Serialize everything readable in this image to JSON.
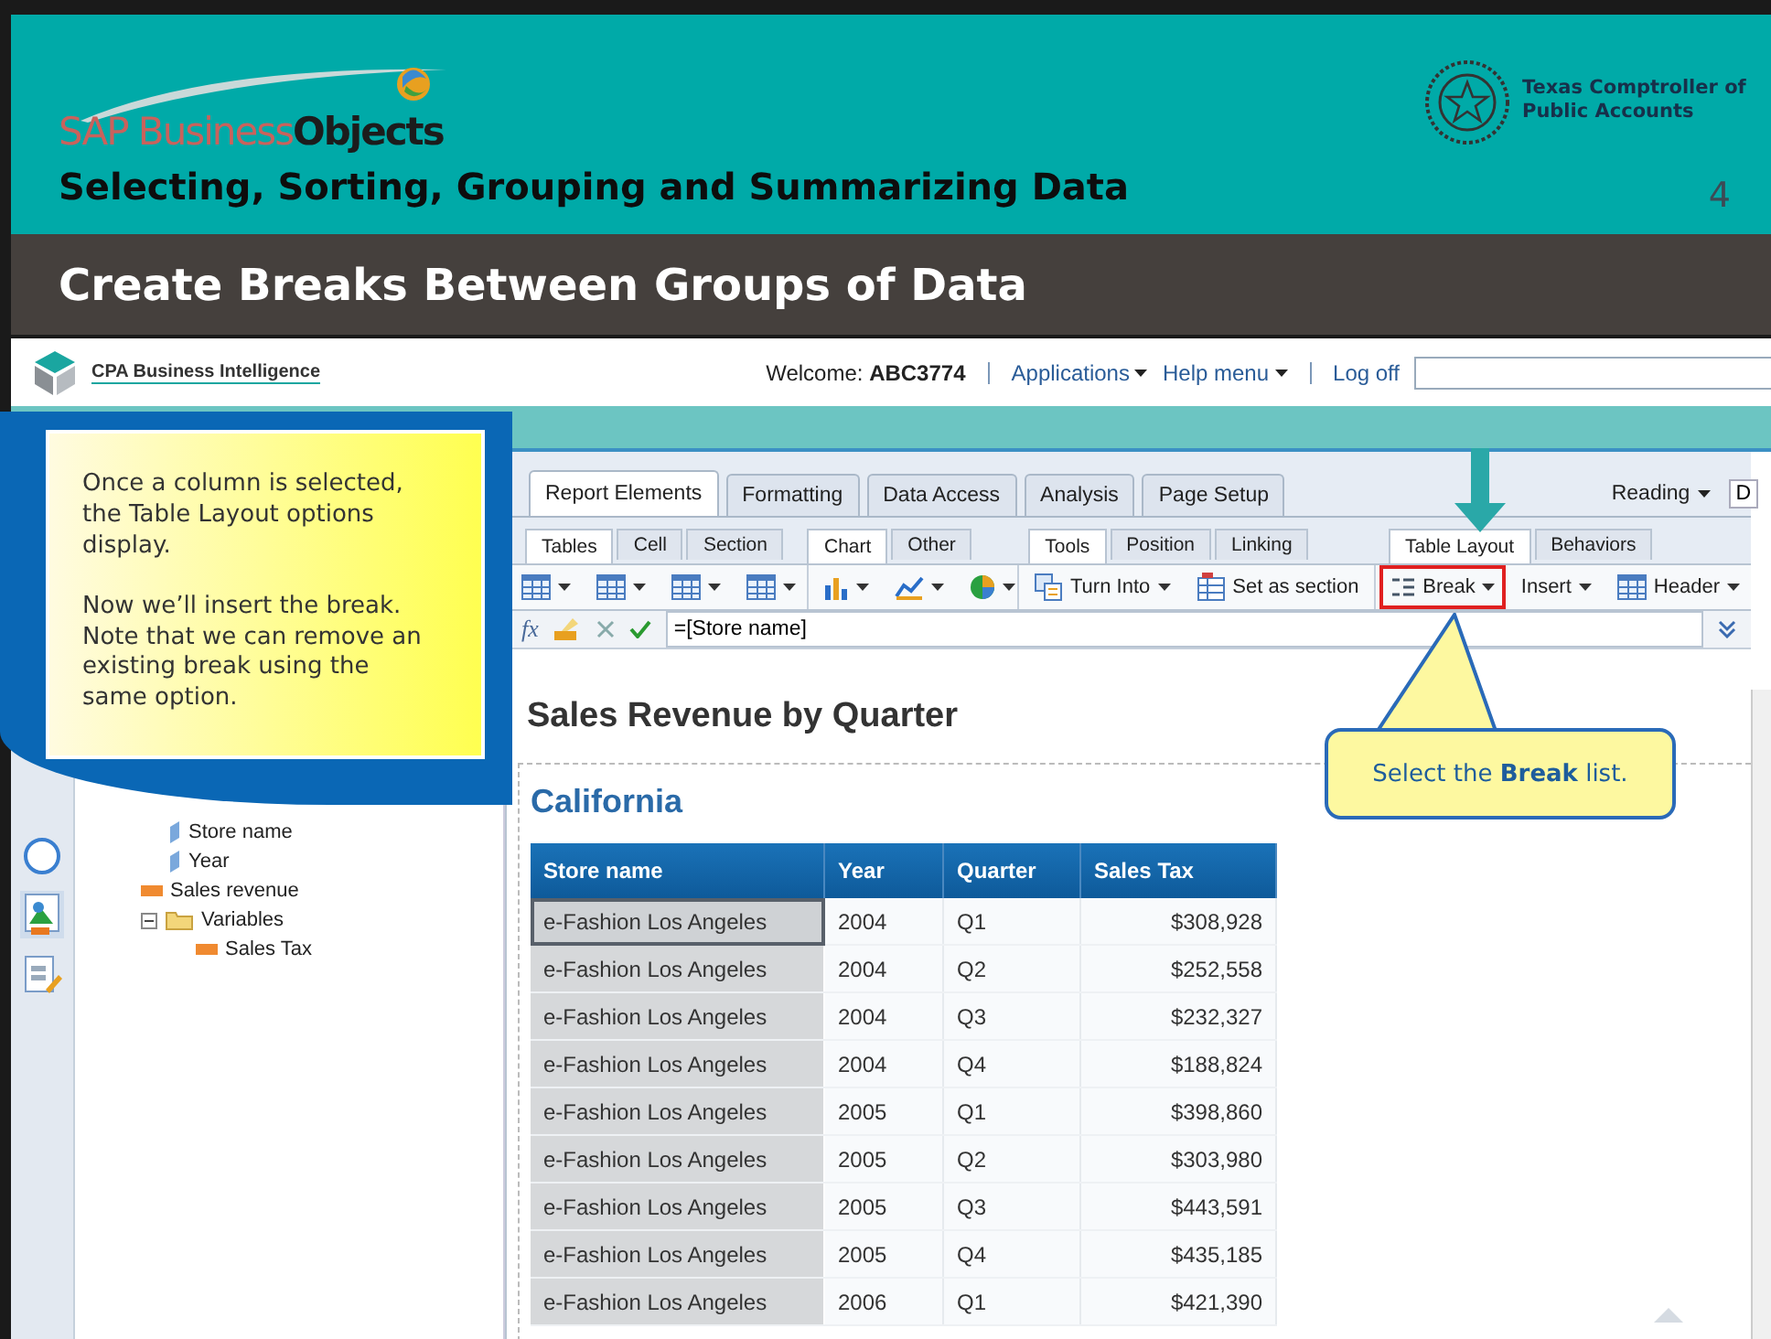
{
  "slide": {
    "logo_part_1": "SAP Business",
    "logo_part_2": "Objects",
    "title": "Selecting, Sorting, Grouping and Summarizing Data",
    "org_name": "Texas Comptroller of Public Accounts",
    "page_number": "4",
    "section_heading": "Create Breaks Between Groups of Data"
  },
  "app": {
    "brand": "CPA Business Intelligence",
    "welcome": "Welcome: **ABC3774**",
    "menus": [
      {
        "label": "Applications"
      },
      {
        "label": "Help menu"
      }
    ],
    "logoff": "Log off",
    "main_tabs": [
      {
        "label": "Report Elements",
        "selected": true
      },
      {
        "label": "Formatting",
        "selected": false
      },
      {
        "label": "Data Access",
        "selected": false
      },
      {
        "label": "Analysis",
        "selected": false
      },
      {
        "label": "Page Setup",
        "selected": false
      }
    ],
    "view_mode": "Reading",
    "mode_button": "D",
    "sub_tab_groups": [
      [
        {
          "label": "Tables",
          "selected": true
        },
        {
          "label": "Cell",
          "selected": false
        },
        {
          "label": "Section",
          "selected": false
        }
      ],
      [
        {
          "label": "Chart",
          "selected": true
        },
        {
          "label": "Other",
          "selected": false
        }
      ],
      [
        {
          "label": "Tools",
          "selected": true
        },
        {
          "label": "Position",
          "selected": false
        },
        {
          "label": "Linking",
          "selected": false
        }
      ],
      [
        {
          "label": "Table Layout",
          "selected": true
        },
        {
          "label": "Behaviors",
          "selected": false
        }
      ]
    ],
    "toolbar_groups": [
      [
        {
          "kind": "icon",
          "dropdown": true,
          "highlighted": false
        },
        {
          "kind": "icon",
          "dropdown": true,
          "highlighted": false
        },
        {
          "kind": "icon",
          "dropdown": true,
          "highlighted": false
        },
        {
          "kind": "icon",
          "dropdown": true,
          "highlighted": false
        }
      ],
      [
        {
          "kind": "icon",
          "dropdown": true,
          "highlighted": false
        },
        {
          "kind": "icon",
          "dropdown": true,
          "highlighted": false
        },
        {
          "kind": "icon",
          "dropdown": true,
          "highlighted": false
        }
      ],
      [
        {
          "kind": "labeled",
          "label": "Turn Into",
          "dropdown": true,
          "highlighted": false
        },
        {
          "kind": "labeled",
          "label": "Set as section",
          "dropdown": false,
          "highlighted": false
        }
      ],
      [
        {
          "kind": "labeled",
          "label": "Break",
          "dropdown": true,
          "highlighted": true
        },
        {
          "kind": "text",
          "label": "Insert",
          "dropdown": true,
          "highlighted": false
        },
        {
          "kind": "labeled",
          "label": "Header",
          "dropdown": true,
          "highlighted": false
        }
      ]
    ],
    "formula_label": "fx",
    "formula": "=[Store name]",
    "tree": [
      {
        "kind": "dimension",
        "label": "Store name"
      },
      {
        "kind": "dimension",
        "label": "Year"
      },
      {
        "kind": "measure",
        "label": "Sales revenue"
      },
      {
        "kind": "folder",
        "label": "Variables",
        "expanded": true,
        "children": [
          {
            "kind": "measure",
            "label": "Sales Tax"
          }
        ]
      }
    ],
    "report_title": "Sales Revenue by Quarter",
    "section": "California",
    "table": {
      "columns": [
        "Store name",
        "Year",
        "Quarter",
        "Sales Tax"
      ],
      "rows": [
        {
          "cells": [
            "e-Fashion Los Angeles",
            "2004",
            "Q1",
            "$308,928"
          ],
          "selected": true
        },
        {
          "cells": [
            "e-Fashion Los Angeles",
            "2004",
            "Q2",
            "$252,558"
          ],
          "selected": false
        },
        {
          "cells": [
            "e-Fashion Los Angeles",
            "2004",
            "Q3",
            "$232,327"
          ],
          "selected": false
        },
        {
          "cells": [
            "e-Fashion Los Angeles",
            "2004",
            "Q4",
            "$188,824"
          ],
          "selected": false
        },
        {
          "cells": [
            "e-Fashion Los Angeles",
            "2005",
            "Q1",
            "$398,860"
          ],
          "selected": false
        },
        {
          "cells": [
            "e-Fashion Los Angeles",
            "2005",
            "Q2",
            "$303,980"
          ],
          "selected": false
        },
        {
          "cells": [
            "e-Fashion Los Angeles",
            "2005",
            "Q3",
            "$443,591"
          ],
          "selected": false
        },
        {
          "cells": [
            "e-Fashion Los Angeles",
            "2005",
            "Q4",
            "$435,185"
          ],
          "selected": false
        },
        {
          "cells": [
            "e-Fashion Los Angeles",
            "2006",
            "Q1",
            "$421,390"
          ],
          "selected": false
        }
      ]
    }
  },
  "instruction": {
    "paragraphs": [
      "Once a column is selected, the Table Layout options display.",
      "Now we’ll insert the break. Note that we can remove an existing break using the same option."
    ]
  },
  "callout": {
    "text": "Select the **Break** list."
  }
}
